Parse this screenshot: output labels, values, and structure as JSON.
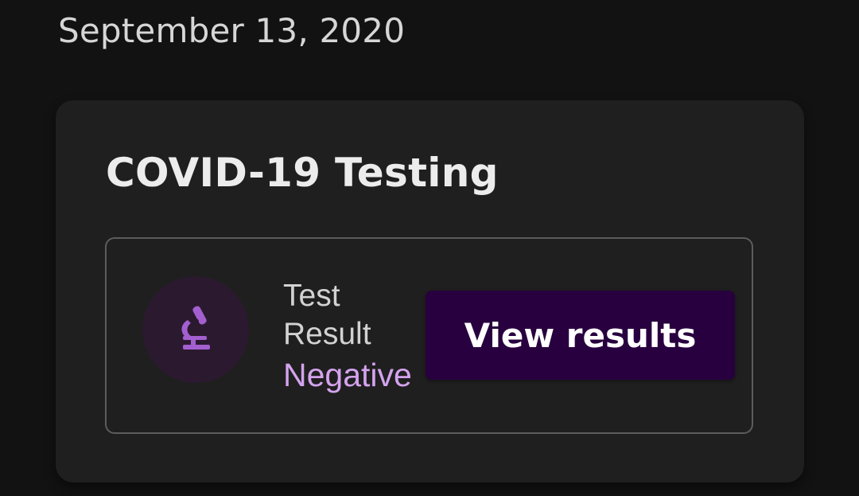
{
  "date_header": "September 13, 2020",
  "card": {
    "title": "COVID-19 Testing",
    "result": {
      "icon": "microscope-icon",
      "label_line1": "Test",
      "label_line2": "Result",
      "value": "Negative",
      "value_color": "#d4a3ee"
    },
    "button_label": "View results",
    "button_color": "#28003f"
  }
}
